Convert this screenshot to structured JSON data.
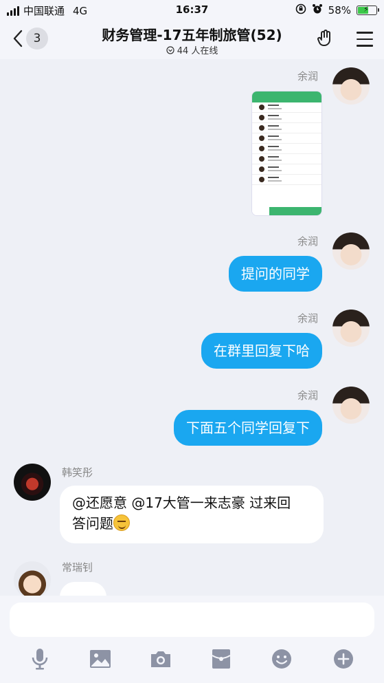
{
  "status_bar": {
    "carrier": "中国联通",
    "network": "4G",
    "time": "16:37",
    "battery": "58%",
    "battery_level": 0.58
  },
  "header": {
    "back_badge": "3",
    "title": "财务管理-17五年制旅管(52)",
    "online": "44 人在线"
  },
  "messages": [
    {
      "sender": "余润",
      "type": "image",
      "outgoing": true
    },
    {
      "sender": "余润",
      "text": "提问的同学",
      "outgoing": true
    },
    {
      "sender": "余润",
      "text": "在群里回复下哈",
      "outgoing": true
    },
    {
      "sender": "余润",
      "text": "下面五个同学回复下",
      "outgoing": true
    },
    {
      "sender": "韩笑彤",
      "text_line1": "@还愿意 @17大管一来志豪 过来回",
      "text_line2": "答问题",
      "emoji": "smirk-emoji",
      "outgoing": false
    },
    {
      "sender": "常瑞钊",
      "text": "",
      "outgoing": false
    }
  ],
  "input": {
    "placeholder": ""
  },
  "toolbar": [
    "microphone-icon",
    "image-icon",
    "camera-icon",
    "red-packet-icon",
    "emoji-icon",
    "plus-icon"
  ],
  "colors": {
    "outgoing_bubble": "#1aa7f0",
    "background": "#eef0f6"
  }
}
